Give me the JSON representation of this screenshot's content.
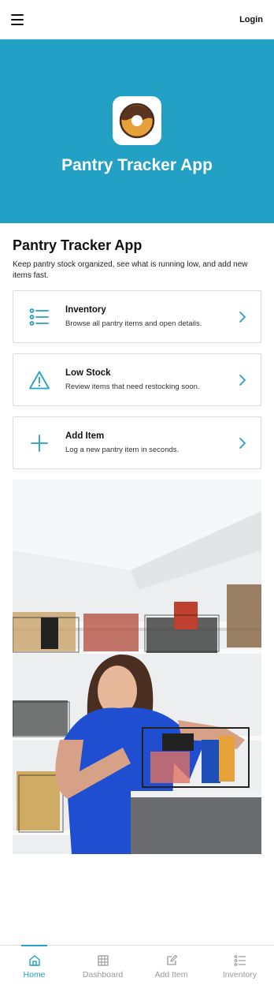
{
  "header": {
    "login_label": "Login"
  },
  "hero": {
    "title": "Pantry Tracker App"
  },
  "intro": {
    "title": "Pantry Tracker App",
    "subtitle": "Keep pantry stock organized, see what is running low, and add new items fast."
  },
  "cards": [
    {
      "title": "Inventory",
      "description": "Browse all pantry items and open details.",
      "icon": "list-icon"
    },
    {
      "title": "Low Stock",
      "description": "Review items that need restocking soon.",
      "icon": "warning-icon"
    },
    {
      "title": "Add Item",
      "description": "Log a new pantry item in seconds.",
      "icon": "plus-icon"
    }
  ],
  "nav": {
    "items": [
      {
        "label": "Home",
        "icon": "home-icon",
        "active": true
      },
      {
        "label": "Dashboard",
        "icon": "grid-icon",
        "active": false
      },
      {
        "label": "Add Item",
        "icon": "edit-icon",
        "active": false
      },
      {
        "label": "Inventory",
        "icon": "list-icon",
        "active": false
      }
    ]
  },
  "colors": {
    "accent": "#22a1c4",
    "inactive": "#9a9a9a"
  }
}
